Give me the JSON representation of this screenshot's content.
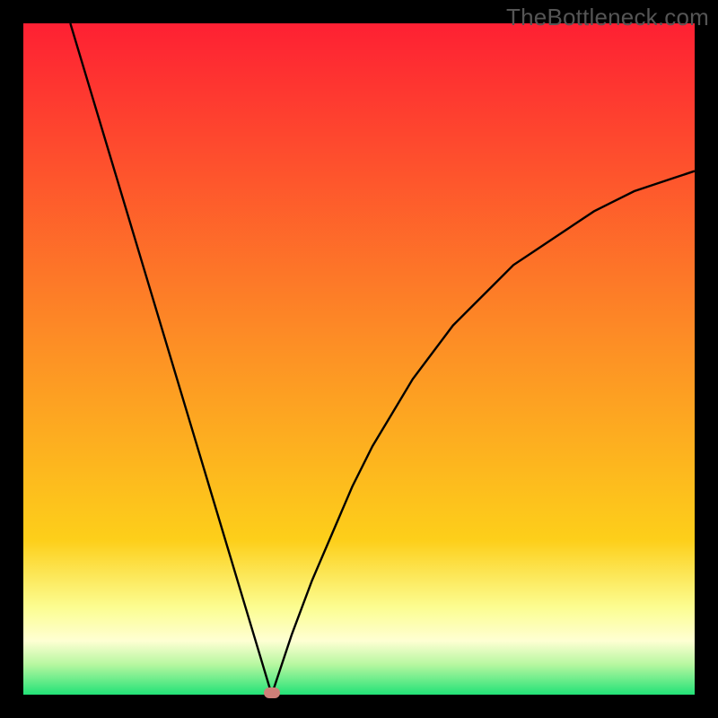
{
  "attribution": "TheBottleneck.com",
  "colors": {
    "page_bg": "#000000",
    "grad_top": "#fe2033",
    "grad_mid": "#fdcf1a",
    "grad_band": "#fcfd91",
    "grad_bottom": "#22e277",
    "curve": "#000000",
    "marker": "#ce7f78",
    "attribution_text": "#555555"
  },
  "chart_data": {
    "type": "line",
    "title": "",
    "xlabel": "",
    "ylabel": "",
    "xlim": [
      0,
      100
    ],
    "ylim": [
      0,
      100
    ],
    "x_min_at": 37,
    "series": [
      {
        "name": "bottleneck-curve",
        "x": [
          7,
          10,
          13,
          16,
          19,
          22,
          25,
          28,
          31,
          34,
          37,
          40,
          43,
          46,
          49,
          52,
          55,
          58,
          61,
          64,
          67,
          70,
          73,
          76,
          79,
          82,
          85,
          88,
          91,
          94,
          97,
          100
        ],
        "y": [
          100,
          90,
          80,
          70,
          60,
          50,
          40,
          30,
          20,
          10,
          0,
          9,
          17,
          24,
          31,
          37,
          42,
          47,
          51,
          55,
          58,
          61,
          64,
          66,
          68,
          70,
          72,
          73.5,
          75,
          76,
          77,
          78
        ]
      }
    ],
    "marker": {
      "x": 37,
      "y": 0
    },
    "gradient_bands": [
      {
        "stop": 0.0,
        "color": "#fe2033"
      },
      {
        "stop": 0.48,
        "color": "#fd8f25"
      },
      {
        "stop": 0.77,
        "color": "#fdcf1a"
      },
      {
        "stop": 0.87,
        "color": "#fcfd91"
      },
      {
        "stop": 0.92,
        "color": "#feffd3"
      },
      {
        "stop": 0.955,
        "color": "#b7f7a0"
      },
      {
        "stop": 1.0,
        "color": "#22e277"
      }
    ]
  }
}
